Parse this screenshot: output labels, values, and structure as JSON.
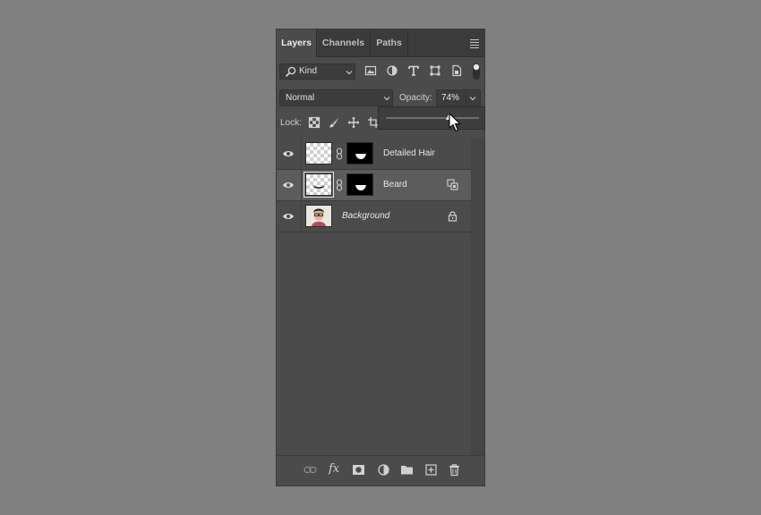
{
  "tabs": [
    {
      "label": "Layers",
      "active": true
    },
    {
      "label": "Channels",
      "active": false
    },
    {
      "label": "Paths",
      "active": false
    }
  ],
  "filter": {
    "kind_label": "Kind",
    "icons": [
      "image-filter-icon",
      "adjustment-filter-icon",
      "type-filter-icon",
      "shape-filter-icon",
      "smart-object-filter-icon",
      "filter-toggle-icon"
    ]
  },
  "blend": {
    "mode": "Normal",
    "opacity_label": "Opacity:",
    "opacity_value": "74%",
    "opacity_fraction": 0.74
  },
  "lock": {
    "label": "Lock:",
    "icons": [
      "lock-transparent-pixels-icon",
      "lock-image-pixels-icon",
      "lock-position-icon",
      "lock-artboard-icon"
    ]
  },
  "layers": [
    {
      "name": "Detailed Hair",
      "visible": true,
      "has_mask": true,
      "selected": false
    },
    {
      "name": "Beard",
      "visible": true,
      "has_mask": true,
      "selected": true,
      "badge": "smart-filter-icon"
    },
    {
      "name": "Background",
      "visible": true,
      "has_mask": false,
      "selected": false,
      "locked": true
    }
  ],
  "bottom_icons": [
    "link-layers-icon",
    "fx-icon",
    "add-mask-icon",
    "adjustment-layer-icon",
    "new-group-icon",
    "new-layer-icon",
    "delete-layer-icon"
  ],
  "fx_label": "fx",
  "colors": {
    "panel": "#4b4b4b",
    "selected_row": "#5c5c5c",
    "background": "#808080"
  }
}
